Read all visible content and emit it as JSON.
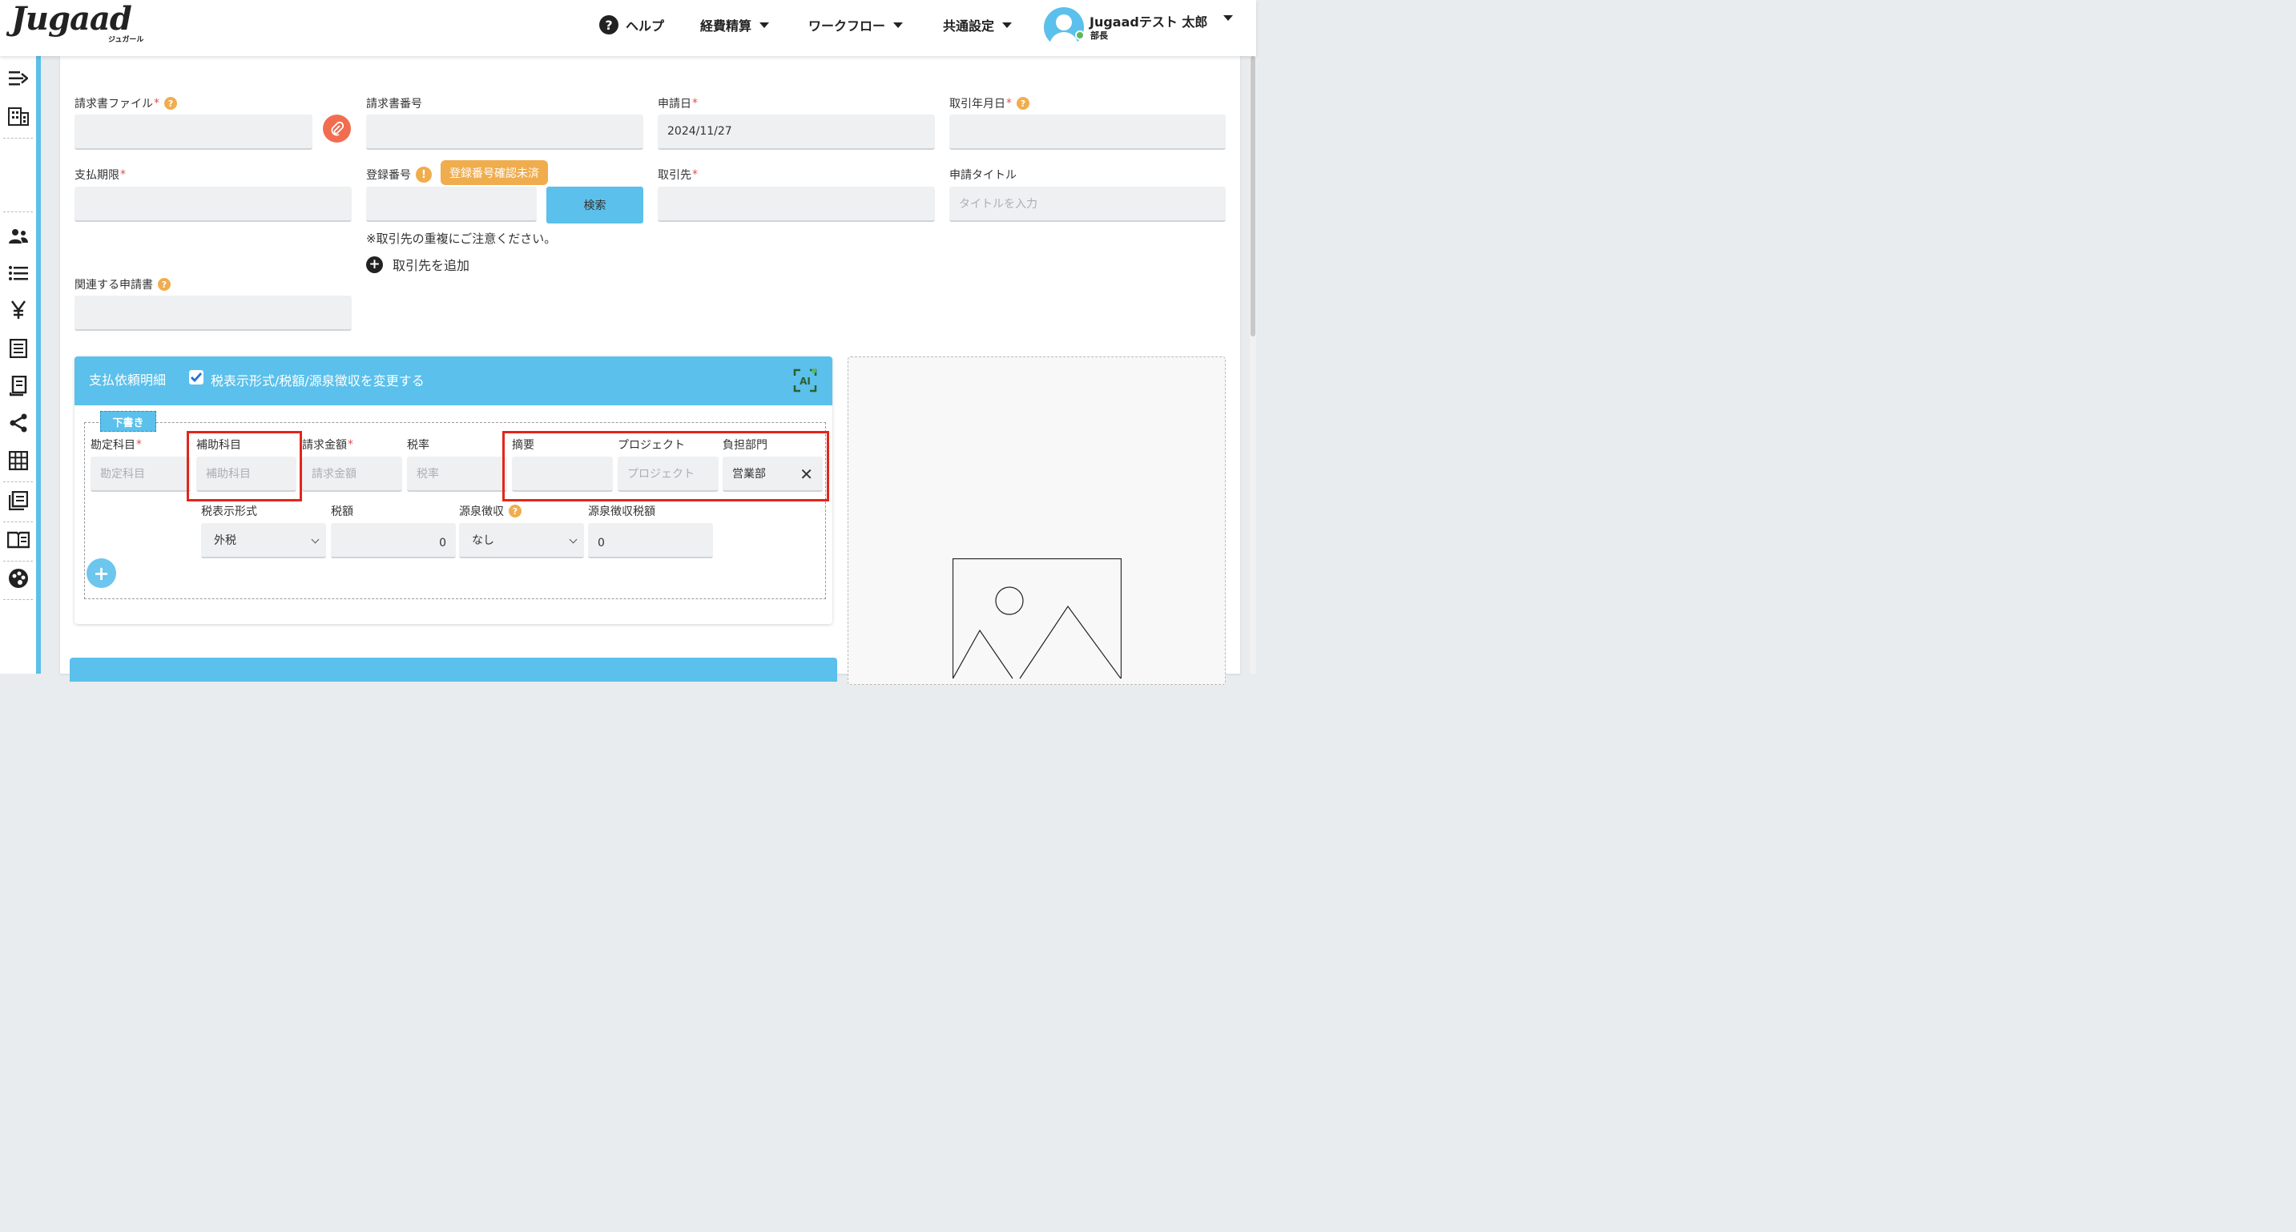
{
  "header": {
    "logo": "Jugaad",
    "logo_sub": "ジュガール",
    "nav": {
      "help": "ヘルプ",
      "expense": "経費精算",
      "workflow": "ワークフロー",
      "common": "共通設定"
    },
    "user": {
      "name": "Jugaadテスト 太郎",
      "role": "部長"
    }
  },
  "form": {
    "invoice_file_label": "請求書ファイル",
    "invoice_number_label": "請求書番号",
    "apply_date_label": "申請日",
    "apply_date_value": "2024/11/27",
    "transaction_date_label": "取引年月日",
    "payment_due_label": "支払期限",
    "registration_number_label": "登録番号",
    "registration_warning": "登録番号確認未済",
    "search_button": "検索",
    "partner_label": "取引先",
    "title_label": "申請タイトル",
    "title_placeholder": "タイトルを入力",
    "duplicate_note": "※取引先の重複にご注意ください。",
    "add_partner": "取引先を追加",
    "related_label": "関連する申請書"
  },
  "payment_detail": {
    "title": "支払依頼明細",
    "change_tax_label": "税表示形式/税額/源泉徴収を変更する",
    "ai_label": "AI",
    "draft_tag": "下書き",
    "account_label": "勘定科目",
    "account_placeholder": "勘定科目",
    "sub_account_label": "補助科目",
    "sub_account_placeholder": "補助科目",
    "amount_label": "請求金額",
    "amount_placeholder": "請求金額",
    "tax_rate_label": "税率",
    "tax_rate_placeholder": "税率",
    "summary_label": "摘要",
    "project_label": "プロジェクト",
    "project_placeholder": "プロジェクト",
    "department_label": "負担部門",
    "department_value": "営業部",
    "tax_display_label": "税表示形式",
    "tax_display_value": "外税",
    "tax_amount_label": "税額",
    "tax_amount_value": "0",
    "withholding_label": "源泉徴収",
    "withholding_value": "なし",
    "withholding_amount_label": "源泉徴収税額",
    "withholding_amount_value": "0"
  },
  "colors": {
    "accent": "#5bc0eb",
    "required": "#d9534f",
    "help_badge": "#f0ad4e",
    "highlight_box": "#e3261a",
    "attach_button": "#f26d50"
  }
}
